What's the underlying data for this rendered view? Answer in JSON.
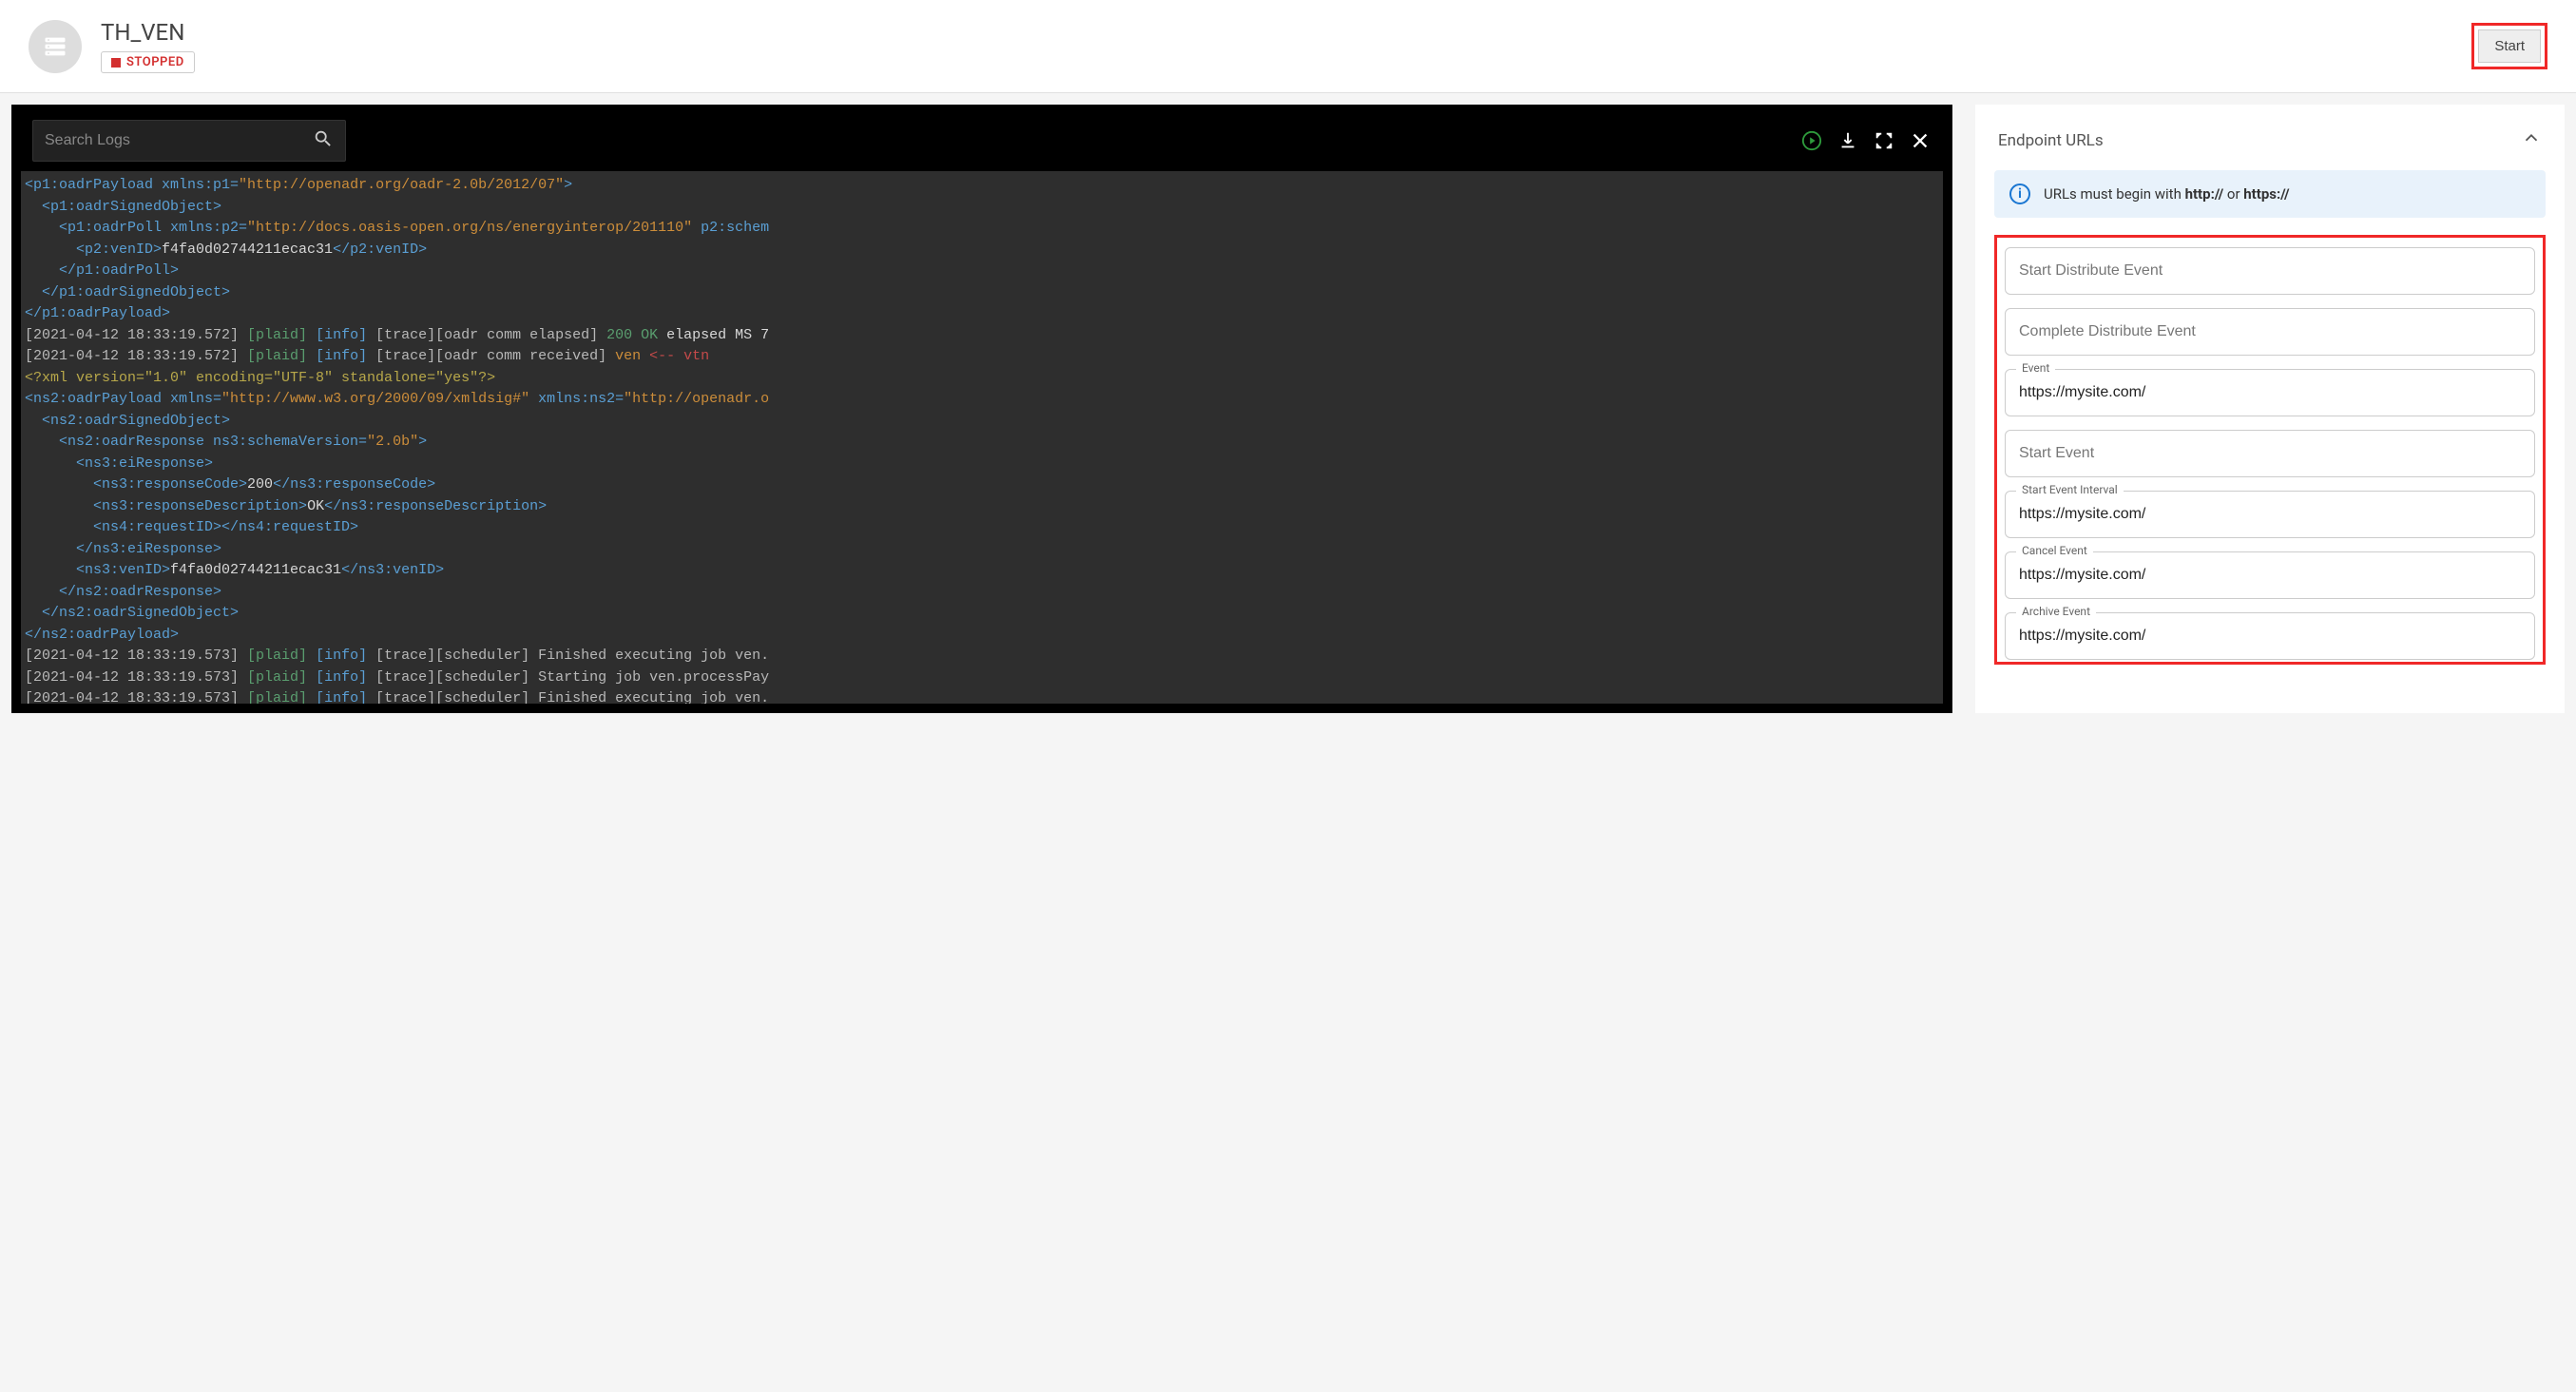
{
  "header": {
    "title": "TH_VEN",
    "status_label": "STOPPED",
    "start_button": "Start"
  },
  "logs": {
    "search_placeholder": "Search Logs",
    "line01a": "<p1:oadrPayload xmlns:p1=",
    "line01b": "\"http://openadr.org/oadr-2.0b/2012/07\"",
    "line01c": ">",
    "line02": "  <p1:oadrSignedObject>",
    "line03a": "    <p1:oadrPoll xmlns:p2=",
    "line03b": "\"http://docs.oasis-open.org/ns/energyinterop/201110\"",
    "line03c": " p2:schem",
    "line04a": "      <p2:venID>",
    "line04b": "f4fa0d02744211ecac31",
    "line04c": "</p2:venID>",
    "line05": "    </p1:oadrPoll>",
    "line06": "  </p1:oadrSignedObject>",
    "line07": "</p1:oadrPayload>",
    "line08a": "[2021-04-12 18:33:19.572] ",
    "line08b": "[plaid] ",
    "line08c": "[info] ",
    "line08d": "[trace][oadr comm elapsed] ",
    "line08e": "200 OK ",
    "line08f": "elapsed MS 7",
    "line09a": "[2021-04-12 18:33:19.572] ",
    "line09b": "[plaid] ",
    "line09c": "[info] ",
    "line09d": "[trace][oadr comm received] ",
    "line09e": "ven ",
    "line09f": "<-- vtn",
    "line10": "<?xml version=\"1.0\" encoding=\"UTF-8\" standalone=\"yes\"?>",
    "line11a": "<ns2:oadrPayload xmlns=",
    "line11b": "\"http://www.w3.org/2000/09/xmldsig#\"",
    "line11c": " xmlns:ns2=",
    "line11d": "\"http://openadr.o",
    "line12": "  <ns2:oadrSignedObject>",
    "line13a": "    <ns2:oadrResponse ns3:schemaVersion=",
    "line13b": "\"2.0b\"",
    "line13c": ">",
    "line14": "      <ns3:eiResponse>",
    "line15a": "        <ns3:responseCode>",
    "line15b": "200",
    "line15c": "</ns3:responseCode>",
    "line16a": "        <ns3:responseDescription>",
    "line16b": "OK",
    "line16c": "</ns3:responseDescription>",
    "line17": "        <ns4:requestID></ns4:requestID>",
    "line18": "      </ns3:eiResponse>",
    "line19a": "      <ns3:venID>",
    "line19b": "f4fa0d02744211ecac31",
    "line19c": "</ns3:venID>",
    "line20": "    </ns2:oadrResponse>",
    "line21": "  </ns2:oadrSignedObject>",
    "line22": "</ns2:oadrPayload>",
    "line23a": "[2021-04-12 18:33:19.573] ",
    "line23b": "[plaid] ",
    "line23c": "[info] ",
    "line23d": "[trace][scheduler] Finished executing job ven.",
    "line24a": "[2021-04-12 18:33:19.573] ",
    "line24b": "[plaid] ",
    "line24c": "[info] ",
    "line24d": "[trace][scheduler] Starting job ven.processPay",
    "line25a": "[2021-04-12 18:33:19.573] ",
    "line25b": "[plaid] ",
    "line25c": "[info] ",
    "line25d": "[trace][scheduler] Finished executing job ven."
  },
  "endpoint_panel": {
    "title": "Endpoint URLs",
    "banner_prefix": "URLs must begin with ",
    "banner_bold1": "http://",
    "banner_mid": " or ",
    "banner_bold2": "https://",
    "fields": {
      "start_distribute": {
        "label": "Start Distribute Event",
        "value": ""
      },
      "complete_distribute": {
        "label": "Complete Distribute Event",
        "value": ""
      },
      "event": {
        "label": "Event",
        "value": "https://mysite.com/"
      },
      "start_event": {
        "label": "Start Event",
        "value": ""
      },
      "start_event_interval": {
        "label": "Start Event Interval",
        "value": "https://mysite.com/"
      },
      "cancel_event": {
        "label": "Cancel Event",
        "value": "https://mysite.com/"
      },
      "archive_event": {
        "label": "Archive Event",
        "value": "https://mysite.com/"
      }
    }
  }
}
